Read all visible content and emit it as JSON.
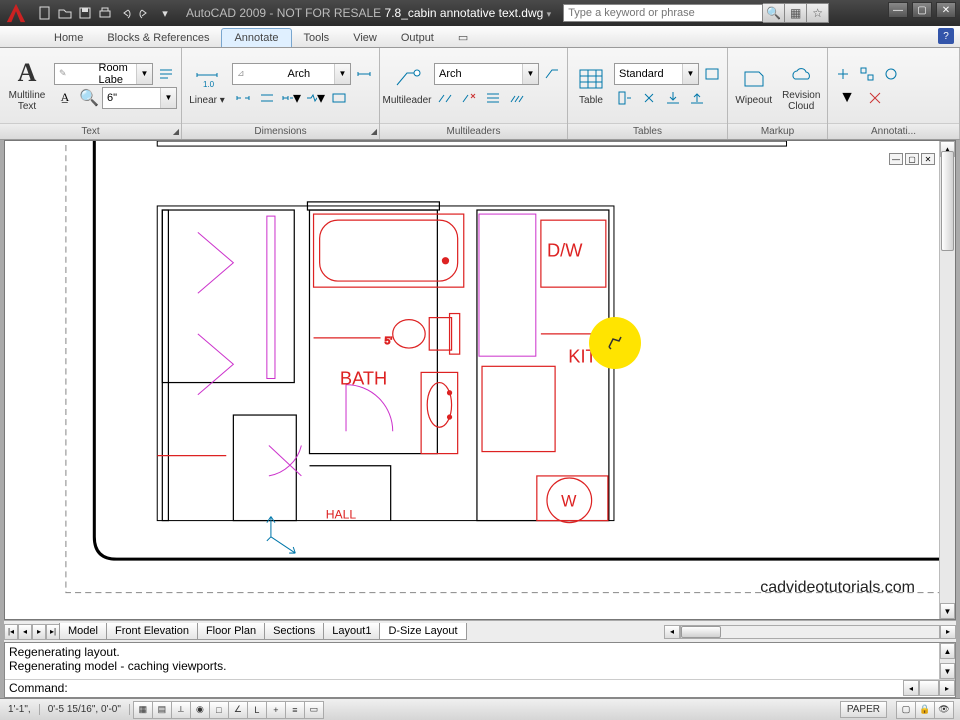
{
  "title": {
    "app": "AutoCAD 2009 - NOT FOR RESALE",
    "file": "7.8_cabin annotative text.dwg"
  },
  "search": {
    "placeholder": "Type a keyword or phrase"
  },
  "tabs": [
    "Home",
    "Blocks & References",
    "Annotate",
    "Tools",
    "View",
    "Output"
  ],
  "active_tab": "Annotate",
  "panels": {
    "text_title": "Text",
    "dims_title": "Dimensions",
    "ml_title": "Multileaders",
    "tbl_title": "Tables",
    "mk_title": "Markup",
    "an_title": "Annotati..."
  },
  "ribbon": {
    "multiline_text": "Multiline\nText",
    "style_combo": "Room Labe",
    "height_combo": "6\"",
    "dim_style": "Arch",
    "linear": "Linear",
    "mleader": "Multileader",
    "ml_style": "Arch",
    "table": "Table",
    "tbl_style": "Standard",
    "wipeout": "Wipeout",
    "revcloud": "Revision\nCloud"
  },
  "labels": {
    "bath": "BATH",
    "kitchen": "KITC",
    "dw": "D/W",
    "w": "W"
  },
  "layout_tabs": [
    "Model",
    "Front Elevation",
    "Floor Plan",
    "Sections",
    "Layout1",
    "D-Size Layout"
  ],
  "active_layout": "D-Size Layout",
  "cmd": {
    "line1": "Regenerating layout.",
    "line2": "Regenerating model - caching viewports.",
    "prompt": "Command:"
  },
  "status": {
    "coord1": "1'-1\",",
    "coord2": "0'-5 15/16\", 0'-0\"",
    "paper": "PAPER"
  },
  "watermark": "cadvideotutorials.com"
}
